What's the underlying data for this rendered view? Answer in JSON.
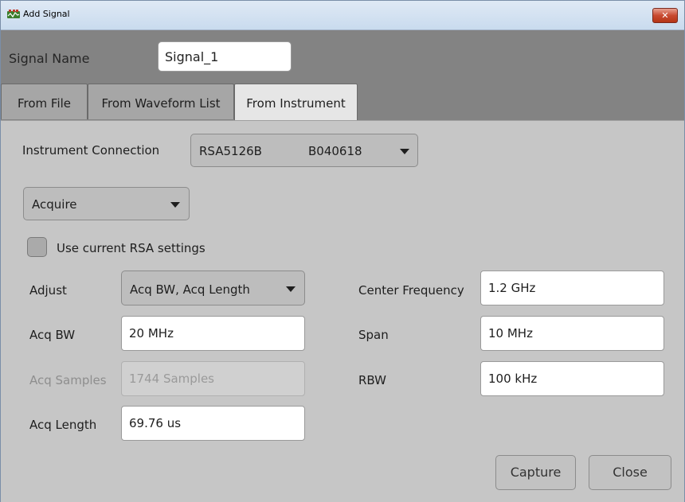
{
  "window": {
    "title": "Add Signal",
    "close_label": "✕"
  },
  "signal_name": {
    "label": "Signal Name",
    "value": "Signal_1"
  },
  "tabs": [
    {
      "label": "From File",
      "active": false
    },
    {
      "label": "From Waveform List",
      "active": false
    },
    {
      "label": "From Instrument",
      "active": true
    }
  ],
  "instrument": {
    "label": "Instrument Connection",
    "model": "RSA5126B",
    "serial": "B040618"
  },
  "mode": {
    "value": "Acquire"
  },
  "use_current": {
    "label": "Use current RSA settings",
    "checked": false
  },
  "left_fields": {
    "adjust_label": "Adjust",
    "adjust_value": "Acq BW, Acq Length",
    "acq_bw_label": "Acq BW",
    "acq_bw_value": "20 MHz",
    "acq_samples_label": "Acq Samples",
    "acq_samples_value": "1744 Samples",
    "acq_length_label": "Acq Length",
    "acq_length_value": "69.76 us"
  },
  "right_fields": {
    "center_freq_label": "Center Frequency",
    "center_freq_value": "1.2 GHz",
    "span_label": "Span",
    "span_value": "10 MHz",
    "rbw_label": "RBW",
    "rbw_value": "100 kHz"
  },
  "buttons": {
    "capture": "Capture",
    "close": "Close"
  }
}
